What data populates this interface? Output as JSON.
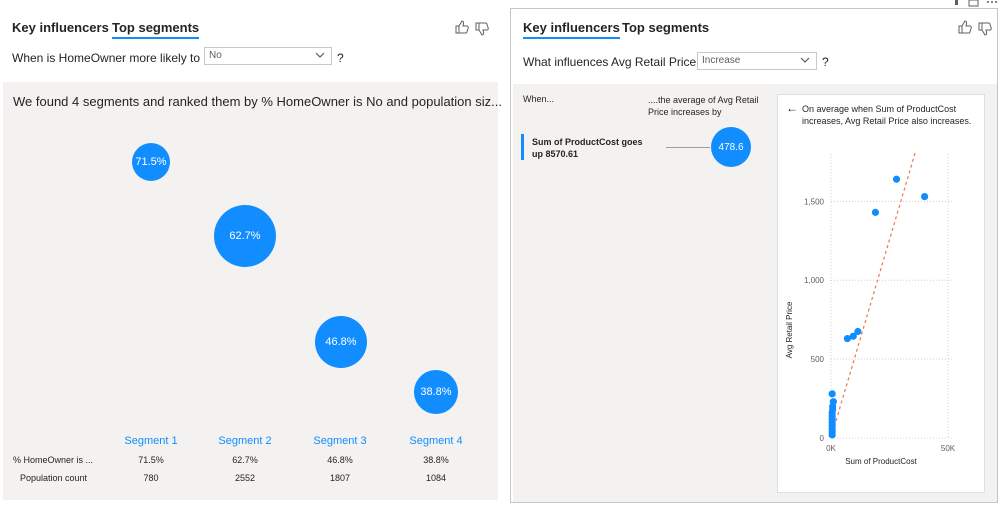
{
  "left": {
    "tabs": [
      "Key influencers",
      "Top segments"
    ],
    "question": "When is HomeOwner more likely to be",
    "dropdown_value": "No",
    "help": "?",
    "summary": "We found 4 segments and ranked them by % HomeOwner is No and population siz...",
    "segments": [
      {
        "label": "Segment 1",
        "pct": "71.5%",
        "count": "780"
      },
      {
        "label": "Segment 2",
        "pct": "62.7%",
        "count": "2552"
      },
      {
        "label": "Segment 3",
        "pct": "46.8%",
        "count": "1807"
      },
      {
        "label": "Segment 4",
        "pct": "38.8%",
        "count": "1084"
      }
    ],
    "row_pct_label": "% HomeOwner is ...",
    "row_count_label": "Population count"
  },
  "right": {
    "tabs": [
      "Key influencers",
      "Top segments"
    ],
    "question": "What influences Avg Retail Price to",
    "dropdown_value": "Increase",
    "help": "?",
    "col_when": "When...",
    "col_avg": "....the average of Avg Retail Price increases by",
    "influencer_label": "Sum of ProductCost goes up 8570.61",
    "influencer_value": "478.6",
    "back_arrow": "←",
    "detail_text": "On average when Sum of ProductCost increases, Avg Retail Price also increases."
  },
  "chart_data": {
    "type": "scatter",
    "xlabel": "Sum of ProductCost",
    "ylabel": "Avg Retail Price",
    "x_ticks": [
      "0K",
      "50K"
    ],
    "y_ticks": [
      "0",
      "500",
      "1,000",
      "1,500"
    ],
    "xlim": [
      0,
      50000
    ],
    "ylim": [
      0,
      1800
    ],
    "grid": true,
    "points": [
      {
        "x": 500,
        "y": 20
      },
      {
        "x": 500,
        "y": 40
      },
      {
        "x": 500,
        "y": 60
      },
      {
        "x": 500,
        "y": 80
      },
      {
        "x": 500,
        "y": 100
      },
      {
        "x": 500,
        "y": 120
      },
      {
        "x": 500,
        "y": 140
      },
      {
        "x": 500,
        "y": 160
      },
      {
        "x": 700,
        "y": 180
      },
      {
        "x": 700,
        "y": 200
      },
      {
        "x": 1000,
        "y": 230
      },
      {
        "x": 500,
        "y": 280
      },
      {
        "x": 7000,
        "y": 630
      },
      {
        "x": 9500,
        "y": 645
      },
      {
        "x": 11500,
        "y": 675
      },
      {
        "x": 19000,
        "y": 1430
      },
      {
        "x": 28000,
        "y": 1640
      },
      {
        "x": 40000,
        "y": 1530
      }
    ],
    "trendline": {
      "x": [
        0,
        36000
      ],
      "y": [
        0,
        1810
      ]
    }
  }
}
